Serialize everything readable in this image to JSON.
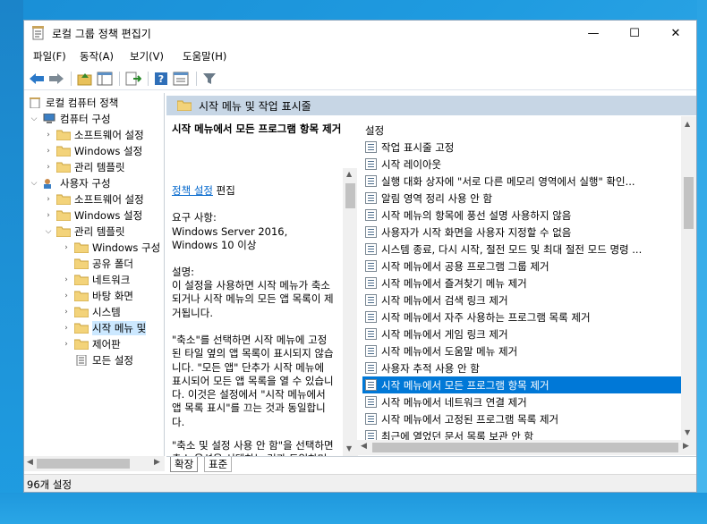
{
  "window": {
    "title": "로컬 그룹 정책 편집기",
    "min_glyph": "—",
    "max_glyph": "☐",
    "close_glyph": "✕"
  },
  "menu": [
    {
      "label": "파일(F)"
    },
    {
      "label": "동작(A)"
    },
    {
      "label": "보기(V)"
    },
    {
      "label": "도움말(H)"
    }
  ],
  "toolbar": {
    "icons": [
      "back-arrow-icon",
      "forward-arrow-icon",
      "folder-up-icon",
      "show-hide-tree-icon",
      "export-list-icon",
      "help-icon",
      "properties-icon",
      "filter-icon"
    ]
  },
  "tree": {
    "items": [
      {
        "label": "로컬 컴퓨터 정책"
      },
      {
        "label": "컴퓨터 구성"
      },
      {
        "label": "소프트웨어 설정"
      },
      {
        "label": "Windows 설정"
      },
      {
        "label": "관리 템플릿"
      },
      {
        "label": "사용자 구성"
      },
      {
        "label": "소프트웨어 설정"
      },
      {
        "label": "Windows 설정"
      },
      {
        "label": "관리 템플릿"
      },
      {
        "label": "Windows 구성"
      },
      {
        "label": "공유 폴더"
      },
      {
        "label": "네트워크"
      },
      {
        "label": "바탕 화면"
      },
      {
        "label": "시스템"
      },
      {
        "label": "시작 메뉴 및"
      },
      {
        "label": "제어판"
      },
      {
        "label": "모든 설정"
      }
    ]
  },
  "content": {
    "header": "시작 메뉴 및 작업 표시줄",
    "desc": {
      "title": "시작 메뉴에서 모든 프로그램 항목 제거",
      "edit_link": "정책 설정",
      "edit_suffix": " 편집",
      "req_label": "요구 사항:",
      "req_value": "Windows Server 2016, Windows 10 이상",
      "desc_label": "설명:",
      "p1": "이 설정을 사용하면 시작 메뉴가 축소되거나 시작 메뉴의 모든 앱 목록이 제거됩니다.",
      "p2": "\"축소\"를 선택하면 시작 메뉴에 고정된 타일 옆의 앱 목록이 표시되지 않습니다. \"모든 앱\" 단추가 시작 메뉴에 표시되어 모든 앱 목록을 열 수 있습니다. 이것은 설정에서 \"시작 메뉴에서 앱 목록 표시\"를 끄는 것과 동일합니다.",
      "p3": "\"축소 및 설정 사용 안 함\"을 선택하면 축소 옵션을 선택하는 것과 동일하며, 설정에서 \"시작 메뉴에"
    },
    "list_header": "설정",
    "settings": [
      "작업 표시줄 고정",
      "시작 레이아웃",
      "실행 대화 상자에 \"서로 다른 메모리 영역에서 실행\" 확인...",
      "알림 영역 정리 사용 안 함",
      "시작 메뉴의 항목에 풍선 설명 사용하지 않음",
      "사용자가 시작 화면을 사용자 지정할 수 없음",
      "시스템 종료, 다시 시작, 절전 모드 및 최대 절전 모드 명령 ...",
      "시작 메뉴에서 공용 프로그램 그룹 제거",
      "시작 메뉴에서 즐겨찾기 메뉴 제거",
      "시작 메뉴에서 검색 링크 제거",
      "시작 메뉴에서 자주 사용하는 프로그램 목록 제거",
      "시작 메뉴에서 게임 링크 제거",
      "시작 메뉴에서 도움말 메뉴 제거",
      "사용자 추적 사용 안 함",
      "시작 메뉴에서 모든 프로그램 항목 제거",
      "시작 메뉴에서 네트워크 연결 제거",
      "시작 메뉴에서 고정된 프로그램 목록 제거",
      "최근에 열었던 문서 목록 보관 안 함"
    ],
    "selected_index": 14
  },
  "tabs": {
    "extended": "확장",
    "standard": "표준"
  },
  "status": {
    "text": "96개 설정"
  },
  "colors": {
    "accent": "#0078d7",
    "header_bg": "#c7d6e5",
    "tree_selection": "#cce8ff",
    "link": "#0066cc"
  }
}
